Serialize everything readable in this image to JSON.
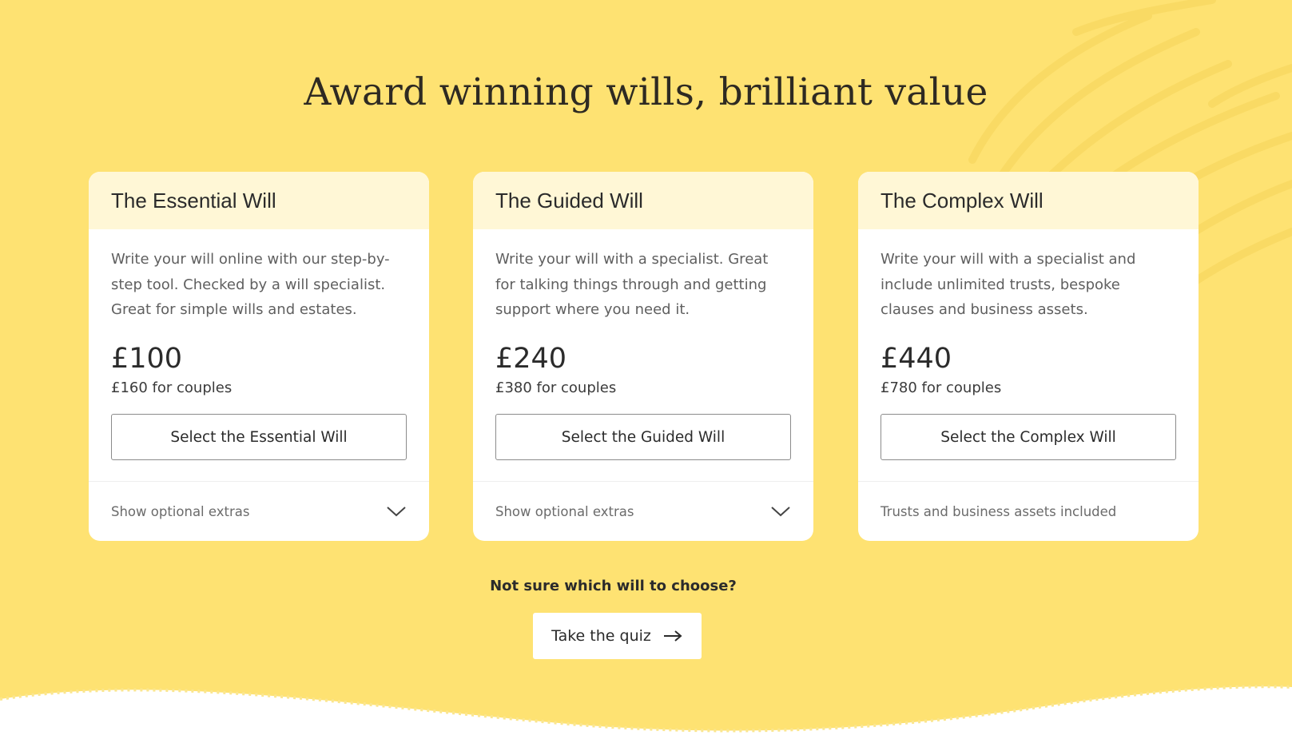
{
  "page": {
    "headline": "Award winning wills, brilliant value",
    "background_color": "#fee272"
  },
  "cards": [
    {
      "title": "The Essential Will",
      "description": "Write your will online with our step-by-step tool. Checked by a will specialist. Great for simple wills and estates.",
      "price": "£100",
      "couples_price": "£160 for couples",
      "button_label": "Select the Essential Will",
      "footer_text": "Show optional extras",
      "footer_icon": "chevron-down-icon"
    },
    {
      "title": "The Guided Will",
      "description": "Write your will with a specialist. Great for talking things through and getting support where you need it.",
      "price": "£240",
      "couples_price": "£380 for couples",
      "button_label": "Select the Guided Will",
      "footer_text": "Show optional extras",
      "footer_icon": "chevron-down-icon"
    },
    {
      "title": "The Complex Will",
      "description": "Write your will with a specialist and include unlimited trusts, bespoke clauses and business assets.",
      "price": "£440",
      "couples_price": "£780 for couples",
      "button_label": "Select the Complex Will",
      "footer_text": "Trusts and business assets included"
    }
  ],
  "quiz": {
    "prompt": "Not sure which will to choose?",
    "button_label": "Take the quiz",
    "button_icon": "arrow-right-icon"
  }
}
